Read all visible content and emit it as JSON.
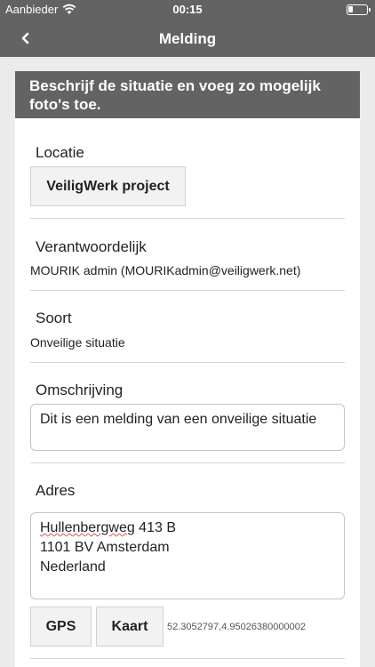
{
  "statusbar": {
    "carrier": "Aanbieder",
    "time": "00:15"
  },
  "navbar": {
    "title": "Melding"
  },
  "intro": "Beschrijf de situatie en voeg zo mogelijk foto's toe.",
  "location": {
    "label": "Locatie",
    "button": "VeiligWerk project"
  },
  "responsible": {
    "label": "Verantwoordelijk",
    "value": "MOURIK admin (MOURIKadmin@veiligwerk.net)"
  },
  "type": {
    "label": "Soort",
    "value": "Onveilige situatie"
  },
  "description": {
    "label": "Omschrijving",
    "value": "Dit is een melding van een onveilige situatie"
  },
  "address": {
    "label": "Adres",
    "street_word": "Hullenbergweg",
    "street_rest": " 413 B",
    "line2": "1101 BV Amsterdam",
    "line3": "Nederland",
    "gps_button": "GPS",
    "map_button": "Kaart",
    "coordinates": "52.3052797,4.95026380000002"
  }
}
